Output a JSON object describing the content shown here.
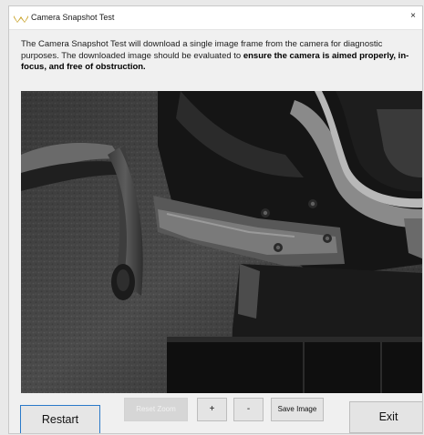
{
  "window": {
    "title": "Camera Snapshot Test",
    "close_glyph": "×"
  },
  "description": {
    "text_normal": "The Camera Snapshot Test will download a single image frame from the camera for diagnostic purposes.  The downloaded image should be evaluated to ",
    "text_bold": "ensure the camera is aimed properly, in-focus, and free of obstruction."
  },
  "buttons": {
    "restart": "Restart",
    "reset_zoom": "Reset Zoom",
    "zoom_in": "+",
    "zoom_out": "-",
    "save_image": "Save Image",
    "exit": "Exit"
  },
  "icons": {
    "app": "camera-app-icon",
    "close": "close-icon"
  },
  "colors": {
    "focus_border": "#2a79c9",
    "disabled_text": "#f1f1f1",
    "app_icon": "#c9a227"
  }
}
